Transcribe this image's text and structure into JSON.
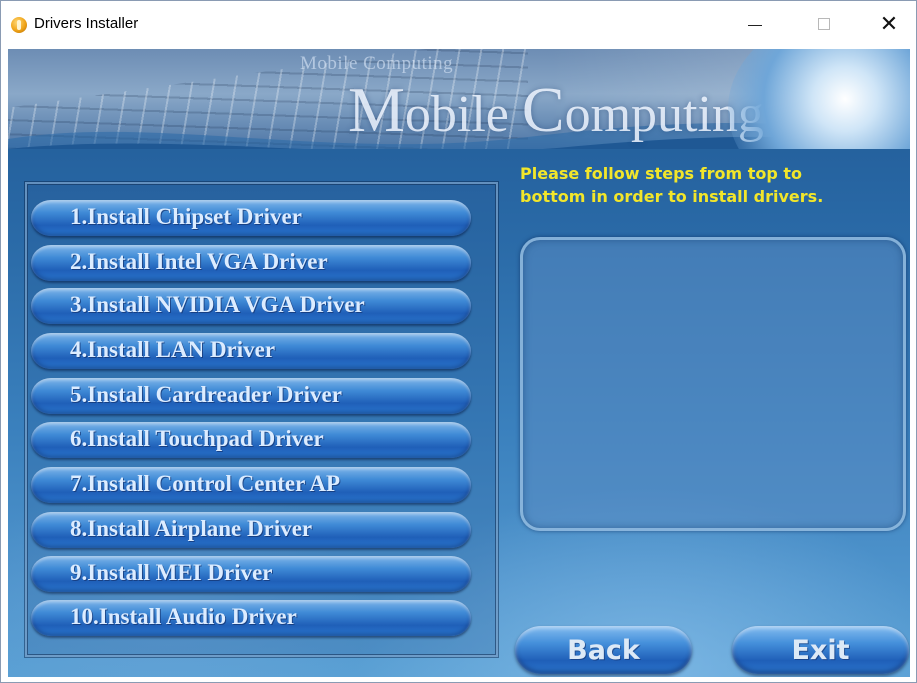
{
  "window": {
    "title": "Drivers Installer",
    "icon": "app-icon",
    "controls": {
      "minimize": "minimize-icon",
      "maximize": "maximize-icon",
      "close_glyph": "✕"
    }
  },
  "banner": {
    "small_text": "Mobile Computing",
    "big_text_cap1": "M",
    "big_text_rest1": "obile ",
    "big_text_cap2": "C",
    "big_text_rest2": "omputing"
  },
  "drivers": [
    {
      "label": "1.Install Chipset Driver"
    },
    {
      "label": "2.Install Intel VGA Driver"
    },
    {
      "label": "3.Install NVIDIA VGA Driver"
    },
    {
      "label": "4.Install LAN Driver"
    },
    {
      "label": "5.Install Cardreader Driver"
    },
    {
      "label": "6.Install Touchpad Driver"
    },
    {
      "label": "7.Install Control Center AP"
    },
    {
      "label": "8.Install Airplane Driver"
    },
    {
      "label": "9.Install MEI Driver"
    },
    {
      "label": "10.Install Audio Driver"
    }
  ],
  "instructions": {
    "line1": "Please follow steps from top to",
    "line2": "bottom in order to install drivers."
  },
  "buttons": {
    "back": "Back",
    "exit": "Exit"
  },
  "colors": {
    "instruction_text": "#f2e62a",
    "button_text": "#dcecff",
    "background_blue": "#2a6aa7"
  }
}
